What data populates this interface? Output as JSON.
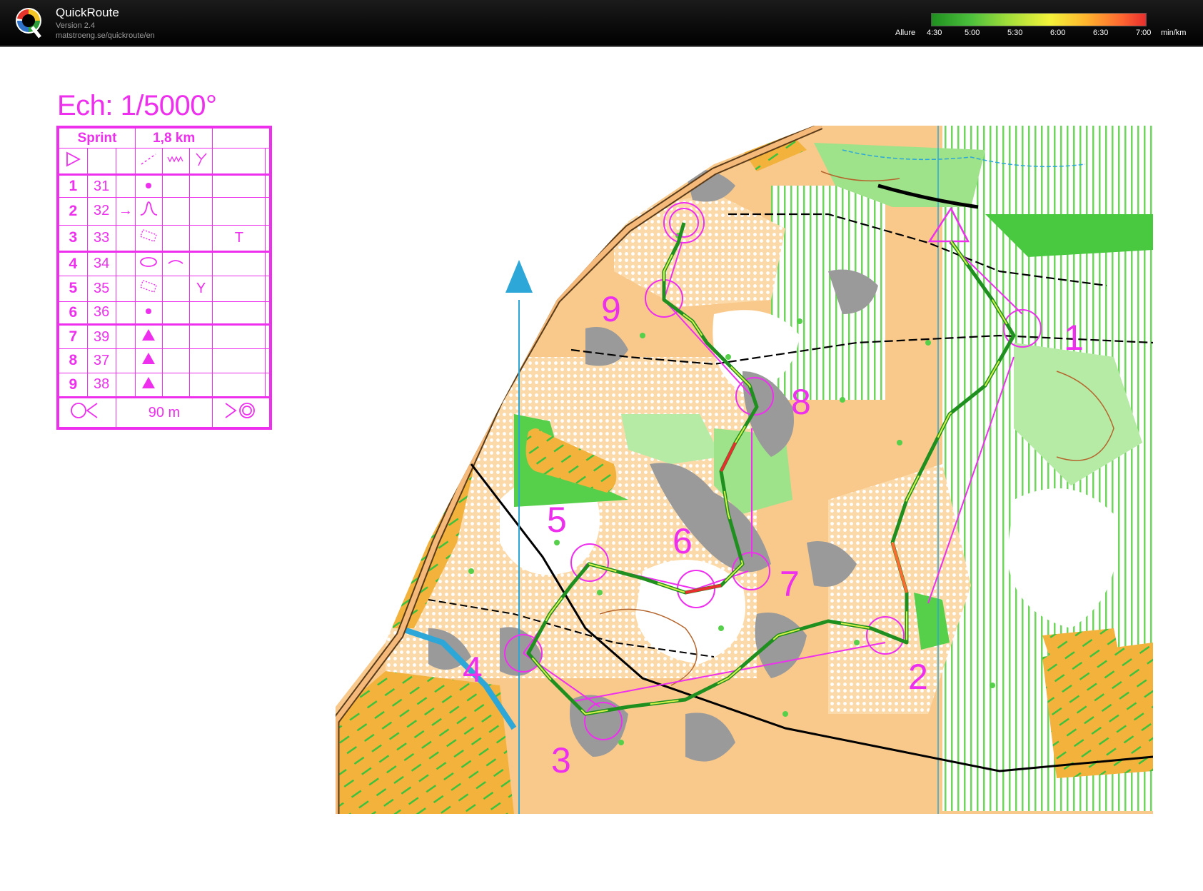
{
  "app": {
    "name": "QuickRoute",
    "version": "Version 2.4",
    "url": "matstroeng.se/quickroute/en"
  },
  "pace_legend": {
    "label": "Allure",
    "ticks": [
      "4:30",
      "5:00",
      "5:30",
      "6:00",
      "6:30",
      "7:00"
    ],
    "unit": "min/km"
  },
  "map": {
    "scale_title": "Ech: 1/5000°",
    "course": {
      "class": "Sprint",
      "length": "1,8 km",
      "finish_distance": "90 m"
    },
    "controls": [
      {
        "number": "1",
        "code": "31",
        "symbol": "dot"
      },
      {
        "number": "2",
        "code": "32",
        "symbol": "re-entrant",
        "direction": "→"
      },
      {
        "number": "3",
        "code": "33",
        "symbol": "rocky-ground",
        "extra": "T"
      },
      {
        "number": "4",
        "code": "34",
        "symbol": "ellipse-knoll",
        "detail": "curve"
      },
      {
        "number": "5",
        "code": "35",
        "symbol": "rocky-ground",
        "extra": "Y"
      },
      {
        "number": "6",
        "code": "36",
        "symbol": "dot"
      },
      {
        "number": "7",
        "code": "39",
        "symbol": "triangle"
      },
      {
        "number": "8",
        "code": "37",
        "symbol": "triangle"
      },
      {
        "number": "9",
        "code": "38",
        "symbol": "triangle"
      }
    ],
    "map_labels": [
      "1",
      "2",
      "3",
      "4",
      "5",
      "6",
      "7",
      "8",
      "9"
    ],
    "colors": {
      "course": "#ee2fee",
      "open_land": "#f7b360",
      "forest_green": "#56d04a",
      "rock": "#9a9a9a",
      "water": "#2ca7d8",
      "track": "#2e7d1e"
    }
  }
}
